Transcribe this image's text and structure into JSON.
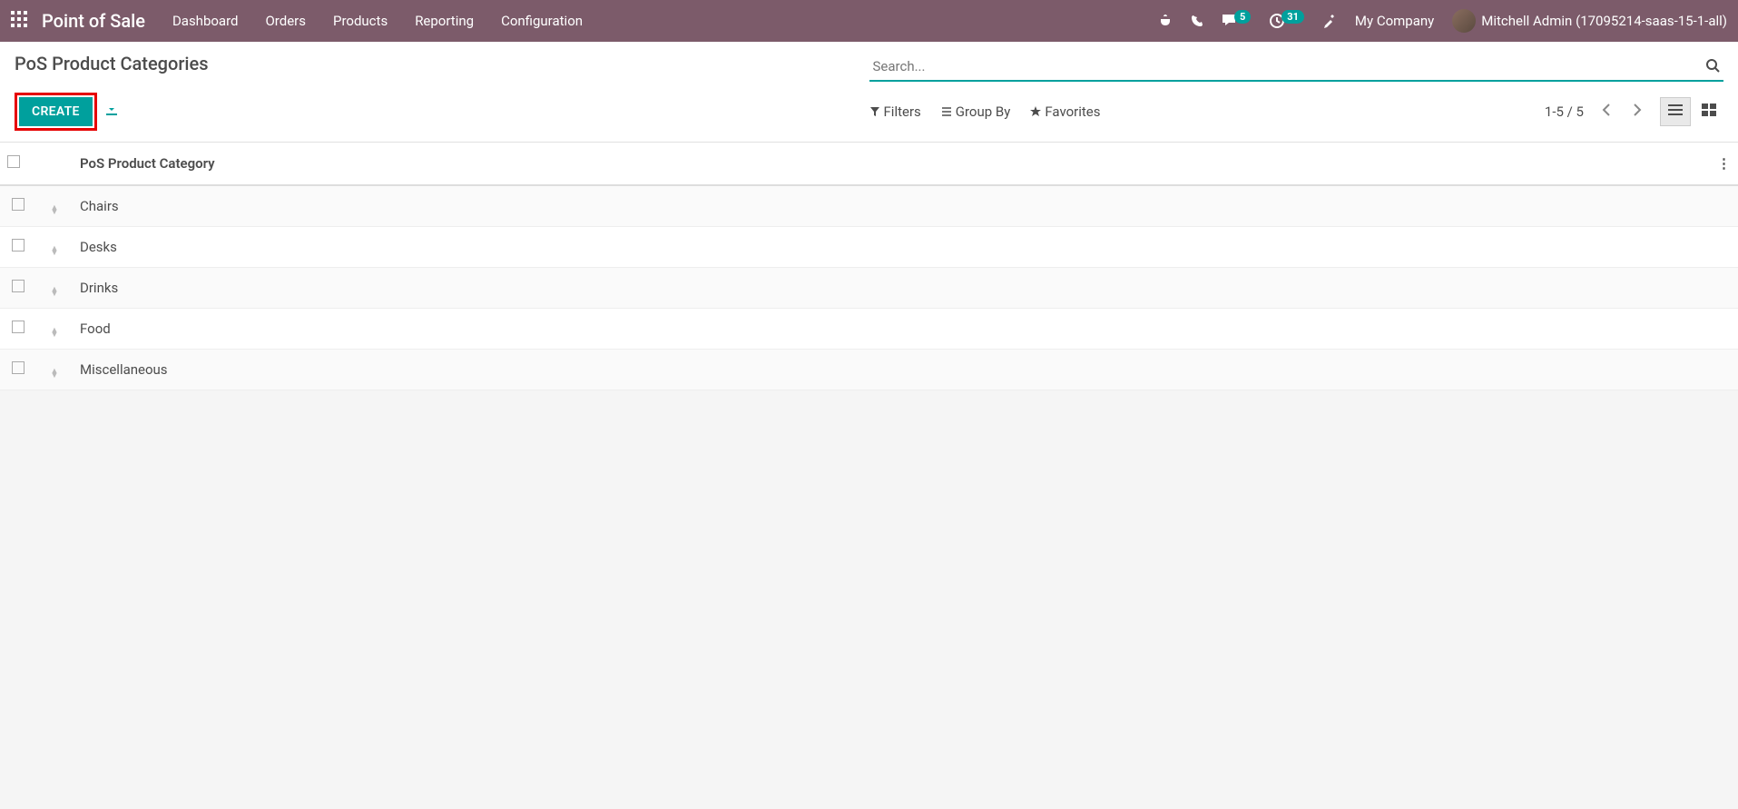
{
  "nav": {
    "app_title": "Point of Sale",
    "menu": [
      "Dashboard",
      "Orders",
      "Products",
      "Reporting",
      "Configuration"
    ],
    "messages_badge": "5",
    "activities_badge": "31",
    "company": "My Company",
    "user": "Mitchell Admin (17095214-saas-15-1-all)"
  },
  "breadcrumb": "PoS Product Categories",
  "search": {
    "placeholder": "Search..."
  },
  "buttons": {
    "create": "CREATE"
  },
  "search_options": {
    "filters": "Filters",
    "group_by": "Group By",
    "favorites": "Favorites"
  },
  "pager": {
    "text": "1-5 / 5"
  },
  "table": {
    "header": "PoS Product Category",
    "rows": [
      {
        "name": "Chairs"
      },
      {
        "name": "Desks"
      },
      {
        "name": "Drinks"
      },
      {
        "name": "Food"
      },
      {
        "name": "Miscellaneous"
      }
    ]
  }
}
